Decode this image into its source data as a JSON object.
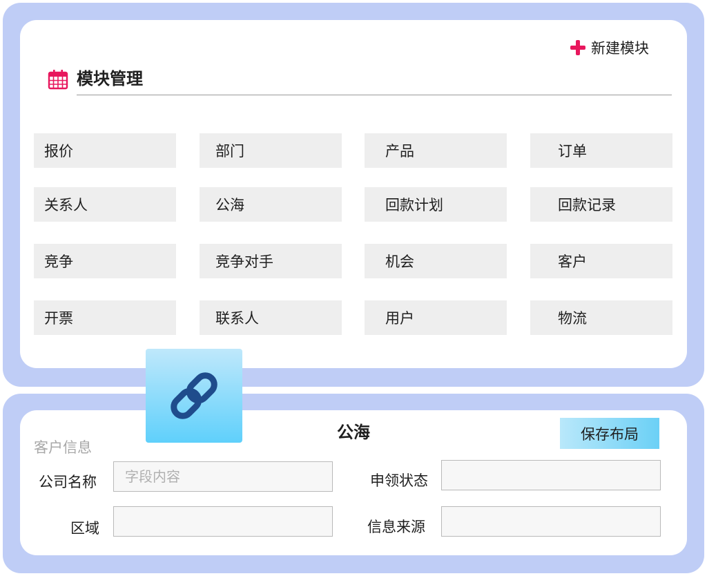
{
  "header": {
    "new_module_label": "新建模块",
    "section_title": "模块管理"
  },
  "modules": [
    [
      "报价",
      "部门",
      "产品",
      "订单"
    ],
    [
      "关系人",
      "公海",
      "回款计划",
      "回款记录"
    ],
    [
      "竞争",
      "竞争对手",
      "机会",
      "客户"
    ],
    [
      "开票",
      "联系人",
      "用户",
      "物流"
    ]
  ],
  "icons": {
    "new_module": "plus-icon",
    "section": "calendar-icon",
    "link": "link-icon"
  },
  "colors": {
    "accent": "#e8175d",
    "frame": "#bfcdf6",
    "tile": "#eeeeee",
    "link_tile_top": "#bfe8fb",
    "link_tile_bottom": "#5fd0fb",
    "link_chain": "#1f4c8c"
  },
  "form": {
    "title": "公海",
    "save_label": "保存布局",
    "section_label": "客户信息",
    "fields": {
      "company": {
        "label": "公司名称",
        "placeholder": "字段内容",
        "value": ""
      },
      "region": {
        "label": "区域",
        "placeholder": "",
        "value": ""
      },
      "status": {
        "label": "申领状态",
        "placeholder": "",
        "value": ""
      },
      "source": {
        "label": "信息来源",
        "placeholder": "",
        "value": ""
      }
    }
  }
}
